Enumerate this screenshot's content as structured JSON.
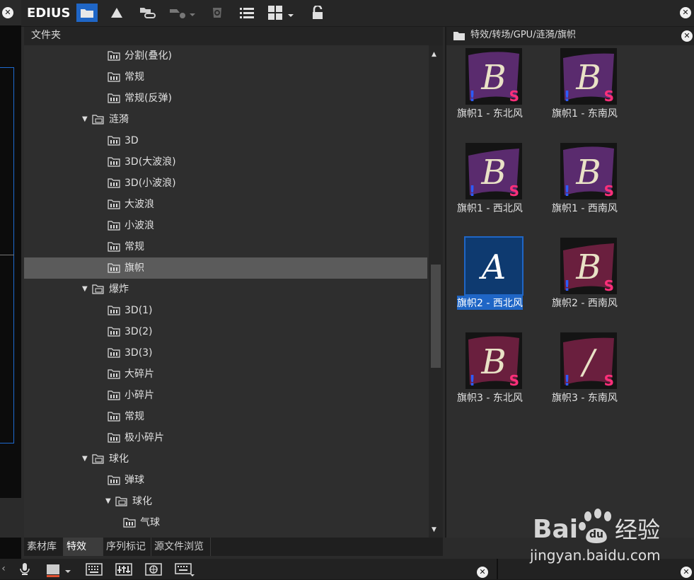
{
  "toolbar": {
    "logo": "EDIUS",
    "icons": [
      "folder-icon",
      "triangle-icon",
      "folder-link-icon",
      "add-dropdown-icon",
      "sync-icon",
      "list-view-icon",
      "grid-view-icon",
      "lock-icon"
    ]
  },
  "folder_panel": {
    "header": "文件夹",
    "nodes": [
      {
        "label": "分割(叠化)",
        "level": 3,
        "expanded": null,
        "selected": false
      },
      {
        "label": "常规",
        "level": 3,
        "expanded": null,
        "selected": false
      },
      {
        "label": "常规(反弹)",
        "level": 3,
        "expanded": null,
        "selected": false
      },
      {
        "label": "涟漪",
        "level": 2,
        "expanded": true,
        "selected": false
      },
      {
        "label": "3D",
        "level": 3,
        "expanded": null,
        "selected": false
      },
      {
        "label": "3D(大波浪)",
        "level": 3,
        "expanded": null,
        "selected": false
      },
      {
        "label": "3D(小波浪)",
        "level": 3,
        "expanded": null,
        "selected": false
      },
      {
        "label": "大波浪",
        "level": 3,
        "expanded": null,
        "selected": false
      },
      {
        "label": "小波浪",
        "level": 3,
        "expanded": null,
        "selected": false
      },
      {
        "label": "常规",
        "level": 3,
        "expanded": null,
        "selected": false
      },
      {
        "label": "旗帜",
        "level": 3,
        "expanded": null,
        "selected": true
      },
      {
        "label": "爆炸",
        "level": 2,
        "expanded": true,
        "selected": false
      },
      {
        "label": "3D(1)",
        "level": 3,
        "expanded": null,
        "selected": false
      },
      {
        "label": "3D(2)",
        "level": 3,
        "expanded": null,
        "selected": false
      },
      {
        "label": "3D(3)",
        "level": 3,
        "expanded": null,
        "selected": false
      },
      {
        "label": "大碎片",
        "level": 3,
        "expanded": null,
        "selected": false
      },
      {
        "label": "小碎片",
        "level": 3,
        "expanded": null,
        "selected": false
      },
      {
        "label": "常规",
        "level": 3,
        "expanded": null,
        "selected": false
      },
      {
        "label": "极小碎片",
        "level": 3,
        "expanded": null,
        "selected": false
      },
      {
        "label": "球化",
        "level": 2,
        "expanded": true,
        "selected": false
      },
      {
        "label": "弹球",
        "level": 3,
        "expanded": null,
        "selected": false
      },
      {
        "label": "球化",
        "level": 3,
        "expanded": true,
        "selected": false
      },
      {
        "label": "气球",
        "level": 4,
        "expanded": null,
        "selected": false
      }
    ]
  },
  "tabs": [
    {
      "label": "素材库",
      "active": false
    },
    {
      "label": "特效",
      "active": true
    },
    {
      "label": "序列标记",
      "active": false
    },
    {
      "label": "源文件浏览",
      "active": false
    }
  ],
  "fx_panel": {
    "path": "特效/转场/GPU/涟漪/旗帜",
    "items": [
      {
        "label": "旗帜1 - 东北风",
        "letter": "B",
        "selected": false,
        "excl": "!",
        "badge": "S"
      },
      {
        "label": "旗帜1 - 东南风",
        "letter": "B",
        "selected": false,
        "excl": "!",
        "badge": "S"
      },
      {
        "label": "旗帜1 - 西北风",
        "letter": "B",
        "selected": false,
        "excl": "!",
        "badge": "S"
      },
      {
        "label": "旗帜1 - 西南风",
        "letter": "B",
        "selected": false,
        "excl": "!",
        "badge": "S"
      },
      {
        "label": "旗帜2 - 西北风",
        "letter": "A",
        "selected": true,
        "excl": "",
        "badge": ""
      },
      {
        "label": "旗帜2 - 西南风",
        "letter": "B",
        "selected": false,
        "excl": "!",
        "badge": "S"
      },
      {
        "label": "旗帜3 - 东北风",
        "letter": "B",
        "selected": false,
        "excl": "!",
        "badge": "S"
      },
      {
        "label": "旗帜3 - 东南风",
        "letter": "/",
        "selected": false,
        "excl": "!",
        "badge": "S"
      }
    ]
  },
  "watermark": {
    "brand": "Bai",
    "brand2": "du",
    "cn": "经验",
    "url": "jingyan.baidu.com"
  },
  "colors": {
    "accent": "#1f66c6",
    "badge": "#ff2f7a",
    "excl": "#2c5cff",
    "flag": "#5a2b6e"
  }
}
